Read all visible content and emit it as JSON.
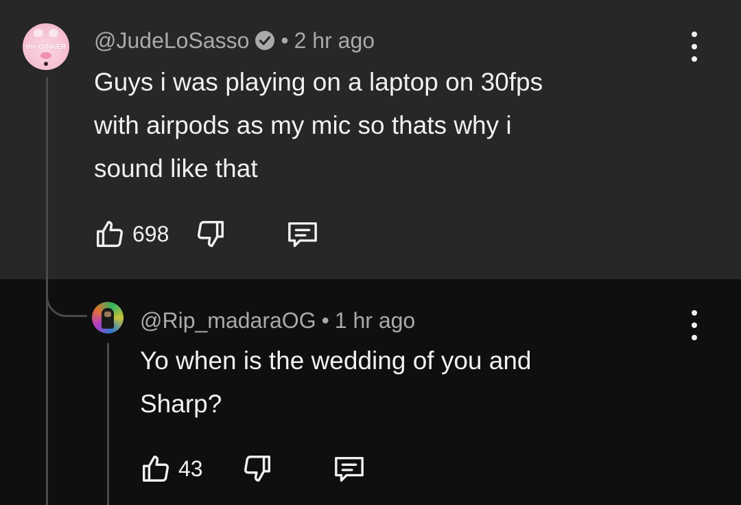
{
  "colors": {
    "top_bg": "#272727",
    "bottom_bg": "#0f0f0f",
    "text_primary": "#f1f1f1",
    "text_secondary": "#aaaaaa",
    "thread_line": "#4a4a4a"
  },
  "comment": {
    "author": "@JudeLoSasso",
    "verified": true,
    "separator": "•",
    "time": "2 hr ago",
    "avatar_text": "the OINKER",
    "text_lines": [
      "Guys i was playing on a laptop on 30fps",
      "with airpods as my mic so thats why i",
      "sound like that"
    ],
    "likes": "698",
    "icons": {
      "like": "thumbs-up-icon",
      "dislike": "thumbs-down-icon",
      "reply": "reply-comment-icon",
      "more": "more-vertical-icon"
    }
  },
  "reply": {
    "author": "@Rip_madaraOG",
    "separator": "•",
    "time": "1 hr ago",
    "text_lines": [
      "Yo when is the wedding of you and",
      "Sharp?"
    ],
    "likes": "43"
  }
}
